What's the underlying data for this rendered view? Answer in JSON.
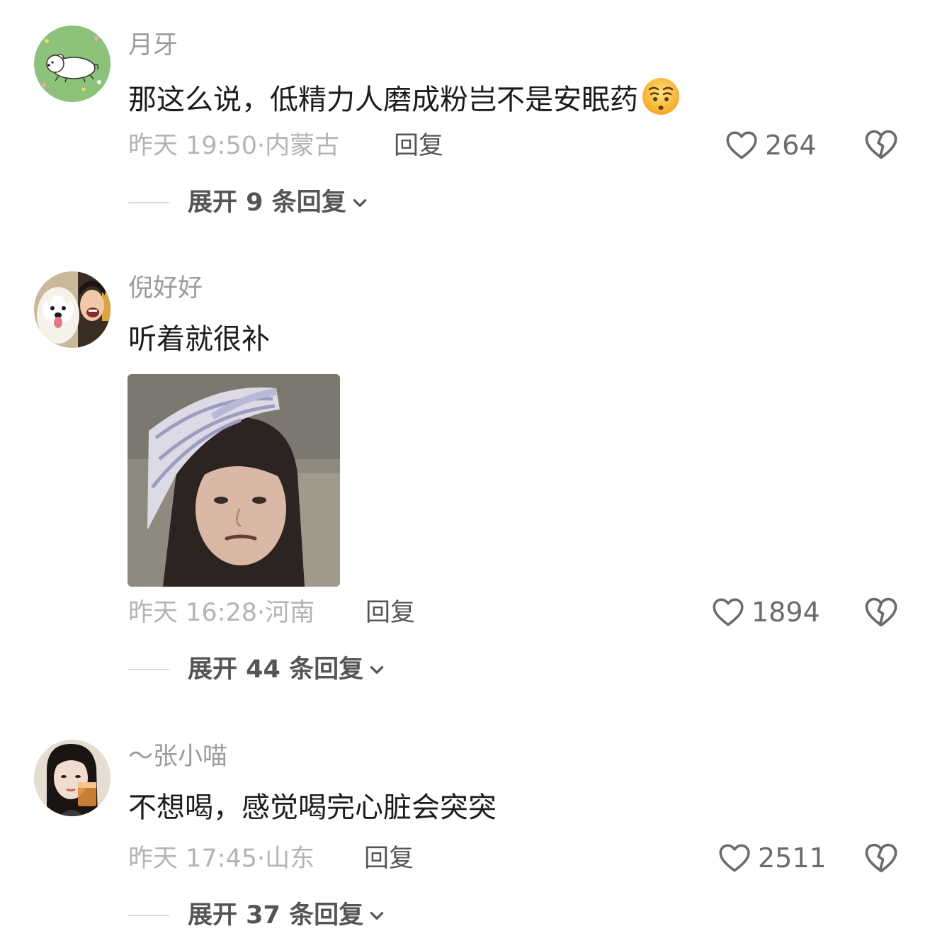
{
  "comments": [
    {
      "username": "月牙",
      "text": "那这么说，低精力人磨成粉岂不是安眠药",
      "emoji": "sleepy-face-emoji",
      "time": "昨天 19:50",
      "location_sep": "·",
      "location": "内蒙古",
      "reply_label": "回复",
      "likes": "264",
      "expand_label": "展开 9 条回复"
    },
    {
      "username": "倪好好",
      "text": "听着就很补",
      "sticker": "meme-sticker-girl-headband",
      "time": "昨天 16:28",
      "location_sep": "·",
      "location": "河南",
      "reply_label": "回复",
      "likes": "1894",
      "expand_label": "展开 44 条回复"
    },
    {
      "username": "～张小喵",
      "text": "不想喝，感觉喝完心脏会突突",
      "time": "昨天 17:45",
      "location_sep": "·",
      "location": "山东",
      "reply_label": "回复",
      "likes": "2511",
      "expand_label": "展开 37 条回复"
    }
  ],
  "icons": {
    "like": "heart-outline-icon",
    "dislike": "broken-heart-icon",
    "expand": "chevron-down-icon"
  },
  "colors": {
    "username": "#9c9c9c",
    "meta": "#b4b4b4",
    "action": "#555555",
    "text": "#1c1c1c"
  }
}
